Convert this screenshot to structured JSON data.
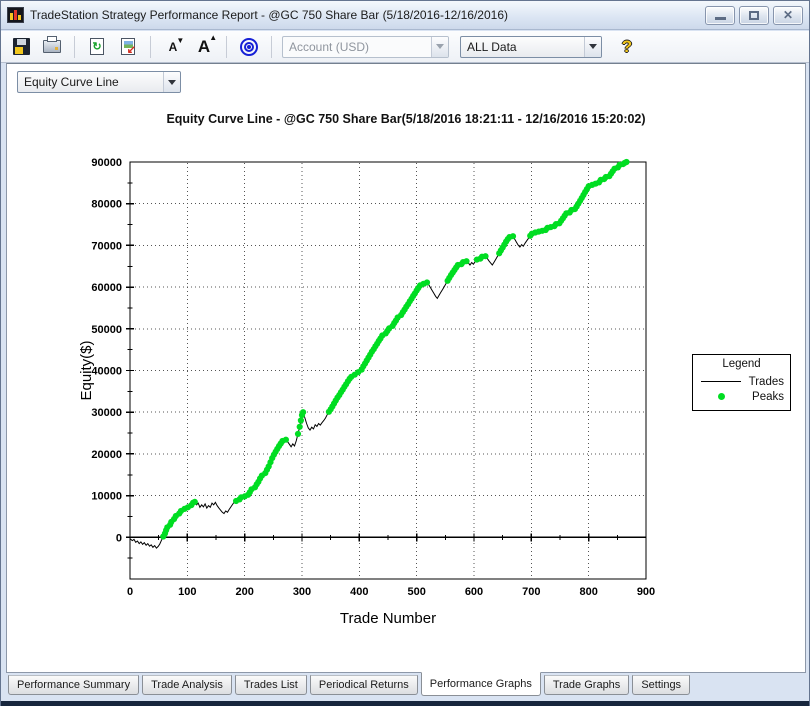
{
  "window": {
    "title": "TradeStation Strategy Performance Report - @GC 750 Share Bar (5/18/2016-12/16/2016)",
    "controls": [
      {
        "name": "minimize"
      },
      {
        "name": "restore"
      },
      {
        "name": "close"
      }
    ]
  },
  "toolbar": {
    "icons": [
      "save",
      "print",
      "refresh",
      "format-report",
      "decrease-font",
      "increase-font",
      "bullseye",
      "help"
    ],
    "account_combo": {
      "value": "Account (USD)",
      "disabled": true
    },
    "range_combo": {
      "value": "ALL Data",
      "disabled": false
    }
  },
  "chart": {
    "selector_value": "Equity Curve Line"
  },
  "legend": {
    "title": "Legend",
    "entries": [
      {
        "label": "Trades",
        "marker": "line",
        "color": "#000000"
      },
      {
        "label": "Peaks",
        "marker": "dot",
        "color": "#00dd22"
      }
    ]
  },
  "tabs": [
    {
      "label": "Performance Summary",
      "active": false
    },
    {
      "label": "Trade Analysis",
      "active": false
    },
    {
      "label": "Trades List",
      "active": false
    },
    {
      "label": "Periodical Returns",
      "active": false
    },
    {
      "label": "Performance Graphs",
      "active": true
    },
    {
      "label": "Trade Graphs",
      "active": false
    },
    {
      "label": "Settings",
      "active": false
    }
  ],
  "chart_data": {
    "type": "line",
    "title": "Equity Curve Line - @GC 750 Share Bar(5/18/2016 18:21:11 - 12/16/2016 15:20:02)",
    "xlabel": "Trade Number",
    "ylabel": "Equity($)",
    "xlim": [
      0,
      900
    ],
    "ylim": [
      -10000,
      90000
    ],
    "xticks": [
      0,
      100,
      200,
      300,
      400,
      500,
      600,
      700,
      800,
      900
    ],
    "yticks": [
      0,
      10000,
      20000,
      30000,
      40000,
      50000,
      60000,
      70000,
      80000,
      90000
    ],
    "x_minor_step": 50,
    "y_minor_step": 5000,
    "grid": "dotted",
    "legend_position": "right-outside",
    "peaks_definition": "green dot at every trade where equity closes at a new running maximum above 0",
    "series": [
      {
        "name": "Trades",
        "type": "line",
        "color": "#000000",
        "points": [
          [
            0,
            -300
          ],
          [
            4,
            -800
          ],
          [
            7,
            -500
          ],
          [
            10,
            -1200
          ],
          [
            13,
            -900
          ],
          [
            16,
            -1500
          ],
          [
            19,
            -1100
          ],
          [
            22,
            -1700
          ],
          [
            25,
            -1300
          ],
          [
            28,
            -1900
          ],
          [
            31,
            -1500
          ],
          [
            34,
            -2100
          ],
          [
            37,
            -1800
          ],
          [
            40,
            -2400
          ],
          [
            43,
            -2000
          ],
          [
            46,
            -2600
          ],
          [
            49,
            -2200
          ],
          [
            52,
            -1600
          ],
          [
            55,
            -700
          ],
          [
            58,
            200
          ],
          [
            61,
            900
          ],
          [
            63,
            1700
          ],
          [
            65,
            2400
          ],
          [
            67,
            2100
          ],
          [
            70,
            3000
          ],
          [
            72,
            3700
          ],
          [
            74,
            3500
          ],
          [
            77,
            4400
          ],
          [
            80,
            5100
          ],
          [
            83,
            4900
          ],
          [
            86,
            5700
          ],
          [
            89,
            6300
          ],
          [
            92,
            6100
          ],
          [
            95,
            6800
          ],
          [
            98,
            6600
          ],
          [
            101,
            7200
          ],
          [
            104,
            7000
          ],
          [
            107,
            7700
          ],
          [
            110,
            8300
          ],
          [
            113,
            8500
          ],
          [
            116,
            7800
          ],
          [
            119,
            8200
          ],
          [
            122,
            7200
          ],
          [
            125,
            7800
          ],
          [
            128,
            7300
          ],
          [
            131,
            8000
          ],
          [
            134,
            7000
          ],
          [
            137,
            7600
          ],
          [
            140,
            7200
          ],
          [
            143,
            8200
          ],
          [
            146,
            7800
          ],
          [
            149,
            8400
          ],
          [
            152,
            7600
          ],
          [
            155,
            7000
          ],
          [
            158,
            6500
          ],
          [
            161,
            6000
          ],
          [
            164,
            5700
          ],
          [
            167,
            6300
          ],
          [
            170,
            6000
          ],
          [
            173,
            6700
          ],
          [
            176,
            7300
          ],
          [
            179,
            7900
          ],
          [
            182,
            8500
          ],
          [
            185,
            8700
          ],
          [
            188,
            8400
          ],
          [
            191,
            9100
          ],
          [
            194,
            9600
          ],
          [
            197,
            9300
          ],
          [
            200,
            9800
          ],
          [
            203,
            9600
          ],
          [
            206,
            10200
          ],
          [
            209,
            10800
          ],
          [
            212,
            11500
          ],
          [
            215,
            11200
          ],
          [
            218,
            12000
          ],
          [
            221,
            12700
          ],
          [
            224,
            13300
          ],
          [
            227,
            14100
          ],
          [
            230,
            14800
          ],
          [
            233,
            14500
          ],
          [
            236,
            15400
          ],
          [
            239,
            16200
          ],
          [
            242,
            17000
          ],
          [
            245,
            18000
          ],
          [
            248,
            19000
          ],
          [
            251,
            19800
          ],
          [
            254,
            20500
          ],
          [
            257,
            21200
          ],
          [
            260,
            21900
          ],
          [
            263,
            22500
          ],
          [
            266,
            23100
          ],
          [
            269,
            22800
          ],
          [
            272,
            23400
          ],
          [
            275,
            22900
          ],
          [
            278,
            22300
          ],
          [
            281,
            21700
          ],
          [
            284,
            22400
          ],
          [
            287,
            21900
          ],
          [
            290,
            23200
          ],
          [
            293,
            24800
          ],
          [
            296,
            26500
          ],
          [
            298,
            28000
          ],
          [
            300,
            29300
          ],
          [
            302,
            30000
          ],
          [
            305,
            28600
          ],
          [
            308,
            27300
          ],
          [
            311,
            26200
          ],
          [
            314,
            25700
          ],
          [
            317,
            26400
          ],
          [
            320,
            26000
          ],
          [
            323,
            27000
          ],
          [
            326,
            26600
          ],
          [
            329,
            27300
          ],
          [
            332,
            26900
          ],
          [
            335,
            27500
          ],
          [
            338,
            28000
          ],
          [
            341,
            28600
          ],
          [
            344,
            29400
          ],
          [
            347,
            30100
          ],
          [
            350,
            30700
          ],
          [
            353,
            31400
          ],
          [
            356,
            32100
          ],
          [
            359,
            32800
          ],
          [
            362,
            33500
          ],
          [
            365,
            34100
          ],
          [
            368,
            34800
          ],
          [
            371,
            35400
          ],
          [
            374,
            36100
          ],
          [
            377,
            36700
          ],
          [
            380,
            37400
          ],
          [
            383,
            38000
          ],
          [
            386,
            38500
          ],
          [
            389,
            38100
          ],
          [
            392,
            39000
          ],
          [
            395,
            38600
          ],
          [
            398,
            39600
          ],
          [
            401,
            39200
          ],
          [
            404,
            40200
          ],
          [
            407,
            41000
          ],
          [
            410,
            41700
          ],
          [
            413,
            42400
          ],
          [
            416,
            43100
          ],
          [
            419,
            43800
          ],
          [
            422,
            44500
          ],
          [
            425,
            45100
          ],
          [
            428,
            45800
          ],
          [
            431,
            46400
          ],
          [
            434,
            47100
          ],
          [
            437,
            47700
          ],
          [
            440,
            48400
          ],
          [
            443,
            48000
          ],
          [
            446,
            48900
          ],
          [
            449,
            49500
          ],
          [
            452,
            50100
          ],
          [
            455,
            49700
          ],
          [
            458,
            50700
          ],
          [
            461,
            51400
          ],
          [
            464,
            52000
          ],
          [
            467,
            52700
          ],
          [
            470,
            52300
          ],
          [
            473,
            53300
          ],
          [
            476,
            54000
          ],
          [
            479,
            54600
          ],
          [
            482,
            55300
          ],
          [
            485,
            55900
          ],
          [
            488,
            56600
          ],
          [
            491,
            57200
          ],
          [
            494,
            57900
          ],
          [
            497,
            58500
          ],
          [
            500,
            59200
          ],
          [
            503,
            59800
          ],
          [
            506,
            60400
          ],
          [
            509,
            60000
          ],
          [
            512,
            60800
          ],
          [
            515,
            60300
          ],
          [
            518,
            61100
          ],
          [
            521,
            60600
          ],
          [
            524,
            59900
          ],
          [
            527,
            59200
          ],
          [
            530,
            58500
          ],
          [
            533,
            57800
          ],
          [
            536,
            57300
          ],
          [
            539,
            58000
          ],
          [
            542,
            58700
          ],
          [
            545,
            59400
          ],
          [
            548,
            60100
          ],
          [
            551,
            60800
          ],
          [
            554,
            61500
          ],
          [
            557,
            62200
          ],
          [
            560,
            62900
          ],
          [
            563,
            63500
          ],
          [
            566,
            64100
          ],
          [
            569,
            64700
          ],
          [
            572,
            65300
          ],
          [
            575,
            64900
          ],
          [
            578,
            65500
          ],
          [
            581,
            66000
          ],
          [
            584,
            65600
          ],
          [
            587,
            66200
          ],
          [
            590,
            65800
          ],
          [
            593,
            65300
          ],
          [
            596,
            65900
          ],
          [
            599,
            65500
          ],
          [
            602,
            66100
          ],
          [
            605,
            66600
          ],
          [
            608,
            66200
          ],
          [
            611,
            66800
          ],
          [
            614,
            67300
          ],
          [
            617,
            66900
          ],
          [
            620,
            67400
          ],
          [
            623,
            66900
          ],
          [
            626,
            66300
          ],
          [
            629,
            65800
          ],
          [
            632,
            65300
          ],
          [
            635,
            66000
          ],
          [
            638,
            66700
          ],
          [
            641,
            67400
          ],
          [
            644,
            68100
          ],
          [
            647,
            68800
          ],
          [
            650,
            69500
          ],
          [
            653,
            70200
          ],
          [
            656,
            70900
          ],
          [
            659,
            71500
          ],
          [
            662,
            72000
          ],
          [
            665,
            71600
          ],
          [
            668,
            72200
          ],
          [
            671,
            71500
          ],
          [
            674,
            70800
          ],
          [
            677,
            70100
          ],
          [
            680,
            69600
          ],
          [
            683,
            70200
          ],
          [
            686,
            69800
          ],
          [
            689,
            70500
          ],
          [
            692,
            71100
          ],
          [
            695,
            71700
          ],
          [
            698,
            72300
          ],
          [
            701,
            72800
          ],
          [
            704,
            72400
          ],
          [
            707,
            73100
          ],
          [
            710,
            72700
          ],
          [
            713,
            73300
          ],
          [
            716,
            72900
          ],
          [
            719,
            73500
          ],
          [
            722,
            73100
          ],
          [
            725,
            73700
          ],
          [
            728,
            74200
          ],
          [
            731,
            73800
          ],
          [
            734,
            74400
          ],
          [
            737,
            74000
          ],
          [
            740,
            74600
          ],
          [
            743,
            75100
          ],
          [
            746,
            74700
          ],
          [
            749,
            75300
          ],
          [
            752,
            75900
          ],
          [
            755,
            76500
          ],
          [
            758,
            77100
          ],
          [
            761,
            77700
          ],
          [
            764,
            77300
          ],
          [
            767,
            77900
          ],
          [
            770,
            78500
          ],
          [
            773,
            78100
          ],
          [
            776,
            78700
          ],
          [
            779,
            79300
          ],
          [
            782,
            80000
          ],
          [
            785,
            80700
          ],
          [
            788,
            81400
          ],
          [
            791,
            82100
          ],
          [
            794,
            82800
          ],
          [
            797,
            83500
          ],
          [
            800,
            84200
          ],
          [
            803,
            83800
          ],
          [
            806,
            84500
          ],
          [
            809,
            84100
          ],
          [
            812,
            84800
          ],
          [
            815,
            84400
          ],
          [
            818,
            85100
          ],
          [
            821,
            85700
          ],
          [
            824,
            85300
          ],
          [
            827,
            85900
          ],
          [
            830,
            86400
          ],
          [
            833,
            86000
          ],
          [
            836,
            86600
          ],
          [
            839,
            87200
          ],
          [
            842,
            87800
          ],
          [
            845,
            88400
          ],
          [
            848,
            88000
          ],
          [
            851,
            88700
          ],
          [
            854,
            89300
          ],
          [
            857,
            88900
          ],
          [
            860,
            89500
          ],
          [
            863,
            89800
          ],
          [
            866,
            90000
          ]
        ]
      },
      {
        "name": "Peaks",
        "type": "scatter",
        "color": "#00dd22",
        "derived_from": "Trades"
      }
    ]
  }
}
